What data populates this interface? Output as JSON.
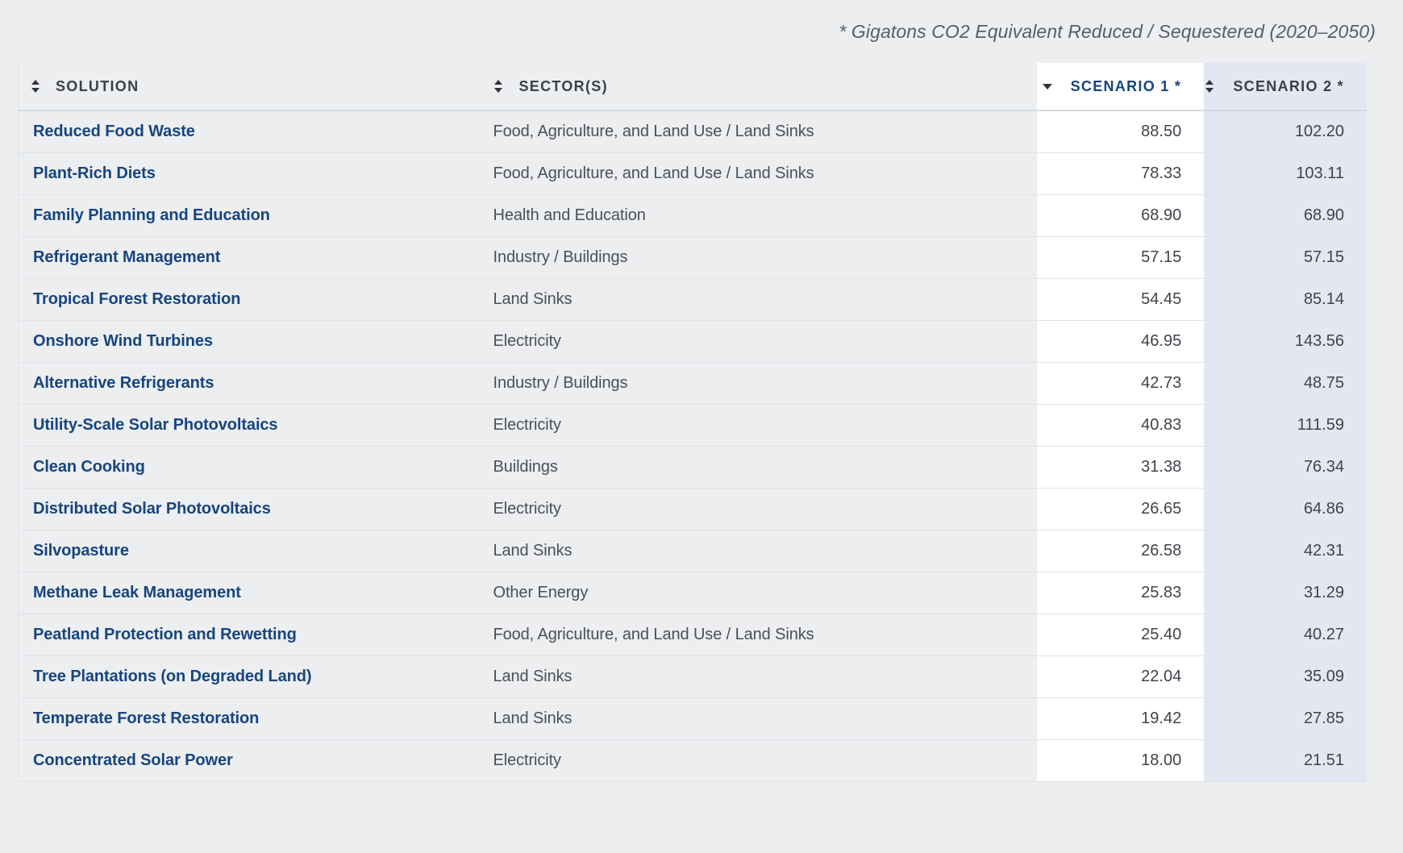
{
  "caption": "* Gigatons CO2 Equivalent Reduced / Sequestered (2020–2050)",
  "table": {
    "columns": [
      {
        "key": "solution",
        "label": "SOLUTION",
        "sort_icon": "sort-updown-icon",
        "sort_state": "none"
      },
      {
        "key": "sectors",
        "label": "SECTOR(S)",
        "sort_icon": "sort-updown-icon",
        "sort_state": "none"
      },
      {
        "key": "scenario_1",
        "label": "SCENARIO 1 *",
        "sort_icon": "sort-down-icon",
        "sort_state": "descending"
      },
      {
        "key": "scenario_2",
        "label": "SCENARIO 2 *",
        "sort_icon": "sort-updown-icon",
        "sort_state": "none"
      }
    ],
    "colors": {
      "page_background": "#eceef0",
      "link_blue": "#17457e",
      "header_text": "#3b4149",
      "scenario_1_background": "#ffffff",
      "scenario_2_background": "#e2e7f1",
      "row_divider": "#dfe3e7"
    },
    "rows": [
      {
        "solution": "Reduced Food Waste",
        "sectors": "Food, Agriculture, and Land Use / Land Sinks",
        "scenario_1": "88.50",
        "scenario_2": "102.20"
      },
      {
        "solution": "Plant-Rich Diets",
        "sectors": "Food, Agriculture, and Land Use / Land Sinks",
        "scenario_1": "78.33",
        "scenario_2": "103.11"
      },
      {
        "solution": "Family Planning and Education",
        "sectors": "Health and Education",
        "scenario_1": "68.90",
        "scenario_2": "68.90"
      },
      {
        "solution": "Refrigerant Management",
        "sectors": "Industry / Buildings",
        "scenario_1": "57.15",
        "scenario_2": "57.15"
      },
      {
        "solution": "Tropical Forest Restoration",
        "sectors": "Land Sinks",
        "scenario_1": "54.45",
        "scenario_2": "85.14"
      },
      {
        "solution": "Onshore Wind Turbines",
        "sectors": "Electricity",
        "scenario_1": "46.95",
        "scenario_2": "143.56"
      },
      {
        "solution": "Alternative Refrigerants",
        "sectors": "Industry / Buildings",
        "scenario_1": "42.73",
        "scenario_2": "48.75"
      },
      {
        "solution": "Utility-Scale Solar Photovoltaics",
        "sectors": "Electricity",
        "scenario_1": "40.83",
        "scenario_2": "111.59"
      },
      {
        "solution": "Clean Cooking",
        "sectors": "Buildings",
        "scenario_1": "31.38",
        "scenario_2": "76.34"
      },
      {
        "solution": "Distributed Solar Photovoltaics",
        "sectors": "Electricity",
        "scenario_1": "26.65",
        "scenario_2": "64.86"
      },
      {
        "solution": "Silvopasture",
        "sectors": "Land Sinks",
        "scenario_1": "26.58",
        "scenario_2": "42.31"
      },
      {
        "solution": "Methane Leak Management",
        "sectors": "Other Energy",
        "scenario_1": "25.83",
        "scenario_2": "31.29"
      },
      {
        "solution": "Peatland Protection and Rewetting",
        "sectors": "Food, Agriculture, and Land Use / Land Sinks",
        "scenario_1": "25.40",
        "scenario_2": "40.27"
      },
      {
        "solution": "Tree Plantations (on Degraded Land)",
        "sectors": "Land Sinks",
        "scenario_1": "22.04",
        "scenario_2": "35.09"
      },
      {
        "solution": "Temperate Forest Restoration",
        "sectors": "Land Sinks",
        "scenario_1": "19.42",
        "scenario_2": "27.85"
      },
      {
        "solution": "Concentrated Solar Power",
        "sectors": "Electricity",
        "scenario_1": "18.00",
        "scenario_2": "21.51"
      }
    ]
  }
}
